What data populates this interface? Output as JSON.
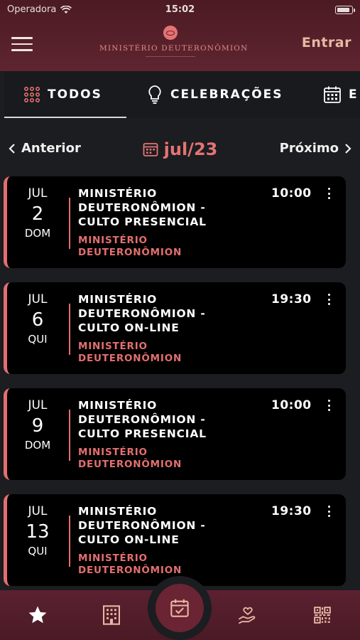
{
  "status_bar": {
    "carrier": "Operadora",
    "time": "15:02"
  },
  "header": {
    "brand_name": "MINISTÉRIO DEUTERONÔMION",
    "login_label": "Entrar"
  },
  "tabs": [
    {
      "label": "TODOS",
      "icon": "grid-icon",
      "active": true
    },
    {
      "label": "CELEBRAÇÕES",
      "icon": "lightbulb-icon",
      "active": false
    },
    {
      "label": "E",
      "icon": "calendar-icon",
      "active": false
    }
  ],
  "month_nav": {
    "prev_label": "Anterior",
    "current_month": "jul/23",
    "next_label": "Próximo"
  },
  "events": [
    {
      "month": "JUL",
      "day": "2",
      "weekday": "DOM",
      "title": "MINISTÉRIO DEUTERONÔMION - CULTO PRESENCIAL",
      "organizer": "MINISTÉRIO DEUTERONÔMION",
      "time": "10:00"
    },
    {
      "month": "JUL",
      "day": "6",
      "weekday": "QUI",
      "title": "MINISTÉRIO DEUTERONÔMION - CULTO ON-LINE",
      "organizer": "MINISTÉRIO DEUTERONÔMION",
      "time": "19:30"
    },
    {
      "month": "JUL",
      "day": "9",
      "weekday": "DOM",
      "title": "MINISTÉRIO DEUTERONÔMION - CULTO PRESENCIAL",
      "organizer": "MINISTÉRIO DEUTERONÔMION",
      "time": "10:00"
    },
    {
      "month": "JUL",
      "day": "13",
      "weekday": "QUI",
      "title": "MINISTÉRIO DEUTERONÔMION - CULTO ON-LINE",
      "organizer": "MINISTÉRIO DEUTERONÔMION",
      "time": "19:30"
    }
  ],
  "bottom_nav": [
    {
      "icon": "star-icon"
    },
    {
      "icon": "building-icon"
    },
    {
      "icon": "calendar-check-icon",
      "active": true
    },
    {
      "icon": "donation-hand-icon"
    },
    {
      "icon": "qr-code-icon"
    }
  ],
  "colors": {
    "accent": "#e46f6f",
    "header_bg": "#5e2530",
    "page_bg": "#1b1d20",
    "card_bg": "#000000",
    "login": "#e9b7a3"
  }
}
